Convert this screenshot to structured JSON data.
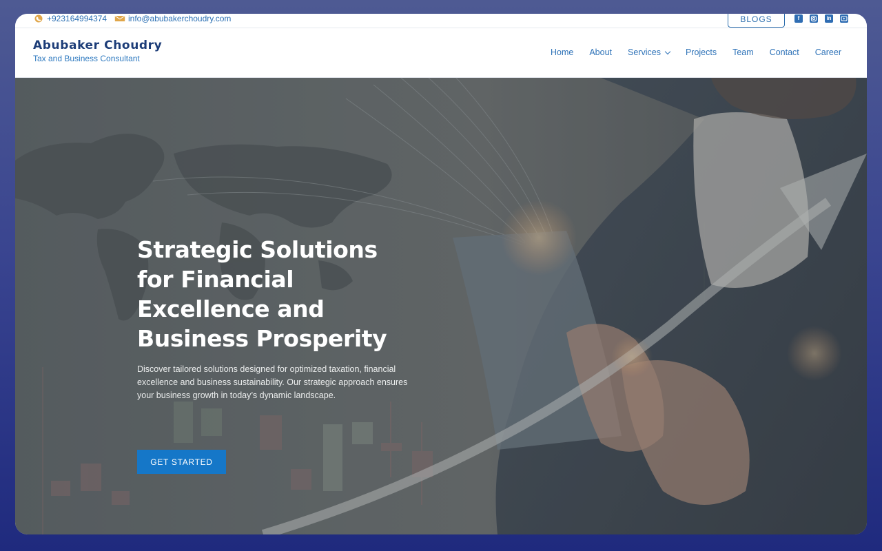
{
  "topbar": {
    "phone": "+923164994374",
    "email": "info@abubakerchoudry.com",
    "blogs_label": "BLOGS",
    "socials": [
      "facebook-icon",
      "instagram-icon",
      "linkedin-icon",
      "youtube-icon"
    ]
  },
  "brand": {
    "name": "Abubaker Choudry",
    "tagline": "Tax and Business Consultant"
  },
  "nav": {
    "items": [
      {
        "label": "Home"
      },
      {
        "label": "About"
      },
      {
        "label": "Services"
      },
      {
        "label": "Projects"
      },
      {
        "label": "Team"
      },
      {
        "label": "Contact"
      },
      {
        "label": "Career"
      }
    ]
  },
  "hero": {
    "title": "Strategic Solutions for Financial Excellence and Business Prosperity",
    "description": "Discover tailored solutions designed for optimized taxation, financial excellence and business sustainability. Our strategic approach ensures your business growth in today’s dynamic landscape.",
    "cta_label": "GET STARTED"
  },
  "colors": {
    "accent": "#1577c8",
    "link": "#2f73b8",
    "brand": "#1d3d78",
    "outer_bg": "#3a4590"
  }
}
